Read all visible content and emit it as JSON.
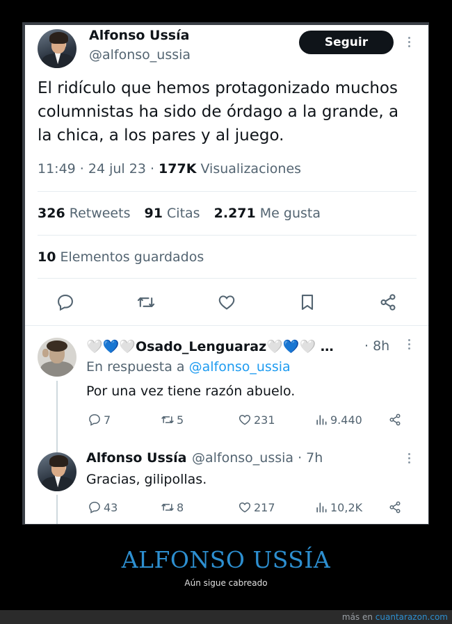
{
  "tweet": {
    "author_name": "Alfonso Ussía",
    "author_handle": "@alfonso_ussia",
    "follow_label": "Seguir",
    "text": "El ridículo que hemos protagonizado muchos columnistas ha sido de órdago a la grande, a la chica, a los pares y al juego.",
    "time": "11:49 · 24 jul 23 · ",
    "views_count": "177K",
    "views_label": " Visualizaciones",
    "retweets_count": "326",
    "retweets_label": "Retweets",
    "quotes_count": "91",
    "quotes_label": "Citas",
    "likes_count": "2.271",
    "likes_label": "Me gusta",
    "saved_count": "10",
    "saved_label": "Elementos guardados"
  },
  "replies": [
    {
      "name": "🤍💙🤍Osado_Lenguaraz🤍💙🤍 …",
      "time": "· 8h",
      "reply_to_prefix": "En respuesta a ",
      "reply_to_handle": "@alfonso_ussia",
      "text": "Por una vez tiene razón abuelo.",
      "replies": "7",
      "retweets": "5",
      "likes": "231",
      "views": "9.440"
    },
    {
      "name": "Alfonso Ussía",
      "handle_time": "@alfonso_ussia · 7h",
      "text": "Gracias, gilipollas.",
      "replies": "43",
      "retweets": "8",
      "likes": "217",
      "views": "10,2K"
    }
  ],
  "caption": {
    "title": "ALFONSO USSÍA",
    "subtitle": "Aún sigue cabreado"
  },
  "footer": {
    "prefix": "más en ",
    "site": "cuantarazon.com"
  },
  "colors": {
    "link": "#1d9bf0",
    "caption_title": "#2d8fd0",
    "follow_button": "#0f1419"
  }
}
